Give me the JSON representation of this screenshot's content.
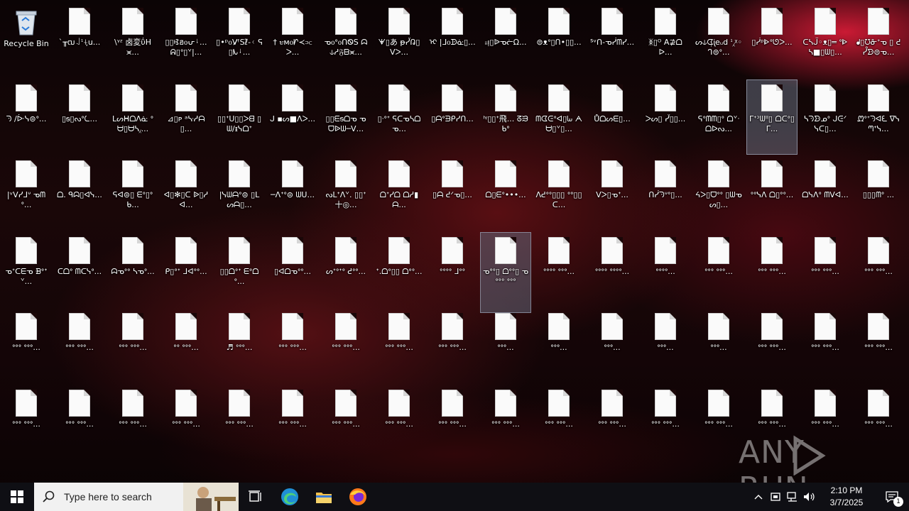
{
  "desktop": {
    "icons": [
      {
        "label": "Recycle Bin",
        "type": "bin"
      },
      {
        "label": "ˋ╥ຒ꒑ᣳ⍭ᝳu...",
        "type": "file"
      },
      {
        "label": "\\ᵞᶻ 卤変ΰH⪤...",
        "type": "file"
      },
      {
        "label": "▯▯ꕙฮ᧐ᕂᛍ... ᕱ▯ᐤ▯ᘁ|...",
        "type": "file"
      },
      {
        "label": "▯•ᵖ᧐V̷ᶠSℓ̃-ᚲ ᕋ▯ᗃᛍ...",
        "type": "file"
      },
      {
        "label": "† ꮜᴍ᧐ᗁ≺⫗ᐳ...",
        "type": "file"
      },
      {
        "label": "ᓀ᧐ᐤ᧐ᑎᏫS ᗣ⫝ᓱ𝔉ᗹ⪤...",
        "type": "file"
      },
      {
        "label": "ᗖ▯あ ᵽᓮᕡ▯Vᐳ...",
        "type": "file"
      },
      {
        "label": "ᢈ |ᒧ᧐ᗬᓎ▯...",
        "type": "file"
      },
      {
        "label": "ᵢᵢᴉ▯ᐉᓀᓖΩ...",
        "type": "file"
      },
      {
        "label": "⊜ᴥᐤ▯ᑎ•▯▯...",
        "type": "file"
      },
      {
        "label": "ᔆᵛᑎ-ᓀᓰᗰᓯ...",
        "type": "file"
      },
      {
        "label": "ᛤ▯ᴼ A⊉ᗝᐅ...",
        "type": "file"
      },
      {
        "label": "ᔕ⫝ᗧ᷊ᶖeᵤd ᣳ⁁ᵡ◦ᒉ⊜ᐤ...",
        "type": "file"
      },
      {
        "label": "▯ᓰᵖᐈᐤᘎᐳ...",
        "type": "file"
      },
      {
        "label": "ᑕᓴᒏ◦ᴥ▯═ ᐤᐈᓴ■▯ᗯ▯...",
        "type": "file"
      },
      {
        "label": "ᖱ▯ᘮᓁᐩᓀ ▯ ᕍᓮᗦ⊜ᓀ...",
        "type": "file"
      },
      {
        "label": "ᘆ /ᐕᓭ⊜ᐤ...",
        "type": "file"
      },
      {
        "label": "▯ᵴ▯ᔓᐤᘇ...",
        "type": "file"
      },
      {
        "label": "ᒪᔕᕼᗝᐱᓎ ᐤᗨ▯ᗨᓴ⁁...",
        "type": "file"
      },
      {
        "label": "⊿▯ᴘ ᵃᔁᓱᗩ▯...",
        "type": "file"
      },
      {
        "label": "▯▯ᐩᑌ▯▯ᐳᗺ ▯ᗯ/ᵻᓭᗝᐩ",
        "type": "file"
      },
      {
        "label": "ᒍ ▪ᔕ■ᐱᐳ...",
        "type": "file"
      },
      {
        "label": "▯▯ᗴᵴᗝᓀ ᓀᗜᐉᗯ─ᐯ...",
        "type": "file"
      },
      {
        "label": "▯ᐧᐤᐩ ᕋᑕᓀᓴᗝᓀ...",
        "type": "file"
      },
      {
        "label": "▯ᗩᐤᗲᑭᓯᑎ...",
        "type": "file"
      },
      {
        "label": "ᴵᵞ▯▯ᐩ飛... ᘔᙐᑲᐤ",
        "type": "file"
      },
      {
        "label": "ᗰᗧᕮᐤᐊ▯ᘈ ᗅᗨ▯ᘁ▯...",
        "type": "file"
      },
      {
        "label": "Ůᗝᔕᗴ▯...",
        "type": "file"
      },
      {
        "label": "ᐳᔕ▯ ᓮ▯▯...",
        "type": "file"
      },
      {
        "label": "ᕋᐤᗰᗰ▯ᐤ ᗝᘁᐧᗝᐅᔓ...",
        "type": "file"
      },
      {
        "label": "ᒥᐩᐣᗯᐦ▯ ᗝᑕᐤ▯ᒥ...",
        "type": "file",
        "selected": true
      },
      {
        "label": "ᓴᘆᗦᓄᐤ ᒍᕮᐟᓭᑕ▯...",
        "type": "file"
      },
      {
        "label": "ᘻᐤᐩᘆᐊᘍ ᐁᓭᘉᐩᓭ...",
        "type": "file"
      },
      {
        "label": "|ᵛᐯᓯᒧᐡ ᓀᗰᐤ...",
        "type": "file"
      },
      {
        "label": "ᗝ. ᑫᗣ▯ᐊᓭ...",
        "type": "file"
      },
      {
        "label": "ᕋᐊ⊜▯ ᗴᐤ▯ᐤᑲ...",
        "type": "file"
      },
      {
        "label": "ᐊ▯✻▯ᑕ ᐉ▯ᓱᐊ...",
        "type": "file"
      },
      {
        "label": "|ᓭᗯᗩᐤ⊜ ▯ᒪᔕᗩ▯...",
        "type": "file"
      },
      {
        "label": "─ᐱᐩᐤ⊜ ᗯᑌ...",
        "type": "file"
      },
      {
        "label": "ᔓᒪᐩᐱᘁ. ▯▯ᐩ十◎...",
        "type": "file"
      },
      {
        "label": "ᗝᐩᓯᗝ ᗝᓱ▮ᗩ...",
        "type": "file"
      },
      {
        "label": "▯ᗩ ᕍᐟᓀ▯...",
        "type": "file"
      },
      {
        "label": "ᗝ▯ᗴᐤ•••...",
        "type": "file"
      },
      {
        "label": "ᐱᕍᐤᐤ▯▯▯ ᐤᐤ▯▯ᑕ...",
        "type": "file"
      },
      {
        "label": "Vᐳ▯ᓀᐩ...",
        "type": "file"
      },
      {
        "label": "ᑎᓰᘆᐡᐤ▯...",
        "type": "file"
      },
      {
        "label": "ᔦᐳ▯ᗜᐤᐤ ▯ᗯᓀᔕ▯...",
        "type": "file"
      },
      {
        "label": "ᐤᐤᓭᐱ ᗝ▯ᐤᐤ...",
        "type": "file"
      },
      {
        "label": "ᗝᓭᐱᐤ ᗰᐯᐊ...",
        "type": "file"
      },
      {
        "label": "▯▯▯ᗰᐤ ...",
        "type": "file"
      },
      {
        "label": "ᓀᐩᑕᗴᓀ ᗽᐤᐩᘁ...",
        "type": "file"
      },
      {
        "label": "ᑕᗝᐤ ᗰᑕᓭᐤ...",
        "type": "file"
      },
      {
        "label": "ᗣᓀᐤᐤ ᓴᓀᐤ...",
        "type": "file"
      },
      {
        "label": "ᑭ▯ᐤᐩ ᒧᐊᐤᐤ...",
        "type": "file"
      },
      {
        "label": "▯▯ᗝᐤᐩ ᗴᐤᗝᐤ...",
        "type": "file"
      },
      {
        "label": "▯ᐊᗝᓀᐤᐤ...",
        "type": "file"
      },
      {
        "label": "ᔕᐩᐤᐩᐤ ᕍᐤᐤ...",
        "type": "file"
      },
      {
        "label": "ᐩ.ᗝᐤ▯▯ ᗝᐤᐤ...",
        "type": "file"
      },
      {
        "label": "ᐤᐤᐤᐤ ᒧᐤᐤ",
        "type": "file"
      },
      {
        "label": "ᓀᐤᐤ▯ ᗝᐤᐤ▯ ᓀᐤᐤᐤ ᐤᐤᐤ",
        "type": "file",
        "selected2": true
      },
      {
        "label": "ᐤᐤᐤᐤ ᐤᐤᐤ...",
        "type": "file"
      },
      {
        "label": "ᐤᐤᐤᐤ ᐤᐤᐤᐤ...",
        "type": "file"
      },
      {
        "label": "ᐤᐤᐤᐤ...",
        "type": "file"
      },
      {
        "label": "ᐤᐤᐤ ᐤᐤᐤ...",
        "type": "file"
      },
      {
        "label": "ᐤᐤᐤ ᐤᐤᐤ...",
        "type": "file"
      },
      {
        "label": "ᐤᐤᐤ ᐤᐤᐤ...",
        "type": "file"
      },
      {
        "label": "ᐤᐤᐤ ᐤᐤᐤ...",
        "type": "file"
      },
      {
        "label": "ᐤᐤᐤ ᐤᐤᐤ...",
        "type": "file"
      },
      {
        "label": "ᐤᐤᐤ ᐤᐤᐤ...",
        "type": "file"
      },
      {
        "label": "ᐤᐤᐤ ᐤᐤᐤ...",
        "type": "file"
      },
      {
        "label": "ᐤᐤ ᐤᐤᐤ...",
        "type": "file"
      },
      {
        "label": "♬ ᐤᐤᐤ...",
        "type": "file"
      },
      {
        "label": "ᐤᐤᐤ ᐤᐤᐤ...",
        "type": "file"
      },
      {
        "label": "ᐤᐤᐤ ᐤᐤᐤ...",
        "type": "file"
      },
      {
        "label": "ᐤᐤᐤ ᐤᐤᐤ...",
        "type": "file"
      },
      {
        "label": "ᐤᐤᐤ ᐤᐤᐤ...",
        "type": "file"
      },
      {
        "label": "ᐤᐤᐤ...",
        "type": "file"
      },
      {
        "label": "ᐤᐤᐤ...",
        "type": "file"
      },
      {
        "label": "ᐤᐤᐤ...",
        "type": "file"
      },
      {
        "label": "ᐤᐤᐤ...",
        "type": "file"
      },
      {
        "label": "ᐤᐤᐤ...",
        "type": "file"
      },
      {
        "label": "ᐤᐤᐤ ᐤᐤᐤ...",
        "type": "file"
      },
      {
        "label": "ᐤᐤᐤ ᐤᐤᐤ...",
        "type": "file"
      },
      {
        "label": "ᐤᐤᐤ ᐤᐤᐤ...",
        "type": "file"
      },
      {
        "label": "ᐤᐤᐤ ᐤᐤᐤ...",
        "type": "file"
      },
      {
        "label": "ᐤᐤᐤ ᐤᐤᐤ...",
        "type": "file"
      },
      {
        "label": "ᐤᐤᐤ ᐤᐤᐤ...",
        "type": "file"
      },
      {
        "label": "ᐤᐤᐤ ᐤᐤᐤ...",
        "type": "file"
      },
      {
        "label": "ᐤᐤᐤ ᐤᐤᐤ...",
        "type": "file"
      },
      {
        "label": "ᐤᐤᐤ ᐤᐤᐤ...",
        "type": "file"
      },
      {
        "label": "ᐤᐤᐤ ᐤᐤᐤ...",
        "type": "file"
      },
      {
        "label": "ᐤᐤᐤ ᐤᐤᐤ...",
        "type": "file"
      },
      {
        "label": "ᐤᐤᐤ ᐤᐤᐤ...",
        "type": "file"
      },
      {
        "label": "ᐤᐤᐤ ᐤᐤᐤ...",
        "type": "file"
      },
      {
        "label": "ᐤᐤᐤ ᐤᐤᐤ...",
        "type": "file"
      },
      {
        "label": "ᐤᐤᐤ ᐤᐤᐤ...",
        "type": "file"
      },
      {
        "label": "ᐤᐤᐤ ᐤᐤᐤ...",
        "type": "file"
      },
      {
        "label": "ᐤᐤᐤ ᐤᐤᐤ...",
        "type": "file"
      },
      {
        "label": "ᐤᐤᐤ ᐤᐤᐤ...",
        "type": "file"
      },
      {
        "label": "ᐤᐤᐤ ᐤᐤᐤ...",
        "type": "file"
      },
      {
        "label": "ᐤᐤᐤ ᐤᐤᐤ...",
        "type": "file"
      }
    ]
  },
  "watermark": {
    "text": "ANY RUN"
  },
  "taskbar": {
    "search_placeholder": "Type here to search",
    "time": "2:10 PM",
    "date": "3/7/2025",
    "notification_count": "1"
  }
}
